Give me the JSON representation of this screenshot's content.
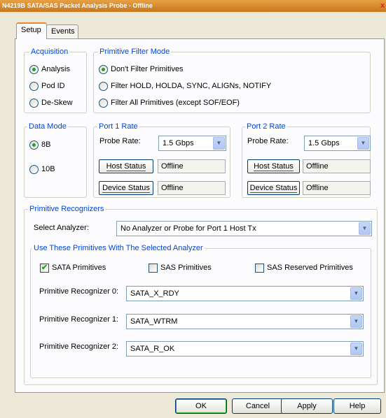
{
  "window": {
    "title": "N4219B SATA/SAS Packet Analysis Probe - Offline",
    "close_glyph": "x"
  },
  "tabs": [
    {
      "label": "Setup",
      "active": true
    },
    {
      "label": "Events",
      "active": false
    }
  ],
  "acquisition": {
    "legend": "Acquisition",
    "options": [
      {
        "label": "Analysis",
        "selected": true
      },
      {
        "label": "Pod ID",
        "selected": false
      },
      {
        "label": "De-Skew",
        "selected": false
      }
    ]
  },
  "filter_mode": {
    "legend": "Primitive Filter Mode",
    "options": [
      {
        "label": "Don't Filter Primitives",
        "selected": true
      },
      {
        "label": "Filter HOLD, HOLDA, SYNC, ALIGNs, NOTIFY",
        "selected": false
      },
      {
        "label": "Filter All Primitives (except SOF/EOF)",
        "selected": false
      }
    ]
  },
  "data_mode": {
    "legend": "Data Mode",
    "options": [
      {
        "label": "8B",
        "selected": true
      },
      {
        "label": "10B",
        "selected": false
      }
    ]
  },
  "port1": {
    "legend": "Port 1 Rate",
    "probe_rate_label": "Probe Rate:",
    "probe_rate_value": "1.5 Gbps",
    "host_status_label": "Host Status",
    "host_status_value": "Offline",
    "device_status_label": "Device Status",
    "device_status_value": "Offline"
  },
  "port2": {
    "legend": "Port 2 Rate",
    "probe_rate_label": "Probe Rate:",
    "probe_rate_value": "1.5 Gbps",
    "host_status_label": "Host Status",
    "host_status_value": "Offline",
    "device_status_label": "Device Status",
    "device_status_value": "Offline"
  },
  "recognizers": {
    "legend": "Primitive Recognizers",
    "select_analyzer_label": "Select Analyzer:",
    "select_analyzer_value": "No Analyzer or Probe for Port 1 Host Tx",
    "subgroup_legend": "Use These Primitives With The Selected Analyzer",
    "checkboxes": [
      {
        "label": "SATA Primitives",
        "checked": true
      },
      {
        "label": "SAS Primitives",
        "checked": false
      },
      {
        "label": "SAS Reserved Primitives",
        "checked": false
      }
    ],
    "items": [
      {
        "label": "Primitive Recognizer 0:",
        "value": "SATA_X_RDY"
      },
      {
        "label": "Primitive Recognizer 1:",
        "value": "SATA_WTRM"
      },
      {
        "label": "Primitive Recognizer 2:",
        "value": "SATA_R_OK"
      }
    ]
  },
  "buttons": {
    "ok": "OK",
    "cancel": "Cancel",
    "apply": "Apply",
    "help": "Help"
  },
  "icons": {
    "dropdown": "chevron-down-icon",
    "check": "✔"
  },
  "colors": {
    "accent": "#e68b2c",
    "legend": "#0046d5",
    "radio_dot": "#21a121"
  }
}
